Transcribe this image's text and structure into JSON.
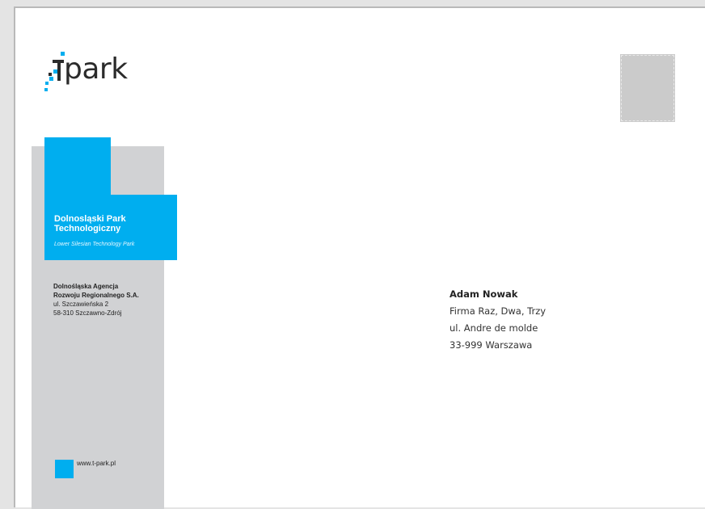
{
  "logo": {
    "text": "park"
  },
  "sender": {
    "park_name": "Dolnosląski Park Technologiczny",
    "park_name_en": "Lower Silesian Technology Park",
    "agency_line1": "Dolnośląska Agencja",
    "agency_line2": "Rozwoju Regionalnego S.A.",
    "street": "ul. Szczawieńska 2",
    "city": "58-310 Szczawno-Zdrój",
    "website": "www.t-park.pl"
  },
  "recipient": {
    "name": "Adam Nowak",
    "company": "Firma Raz, Dwa, Trzy",
    "street": "ul. Andre de molde",
    "city": "33-999 Warszawa"
  },
  "colors": {
    "brand_blue": "#00aeef",
    "band_grey": "#d1d2d4",
    "stamp_grey": "#cbcbcb"
  }
}
